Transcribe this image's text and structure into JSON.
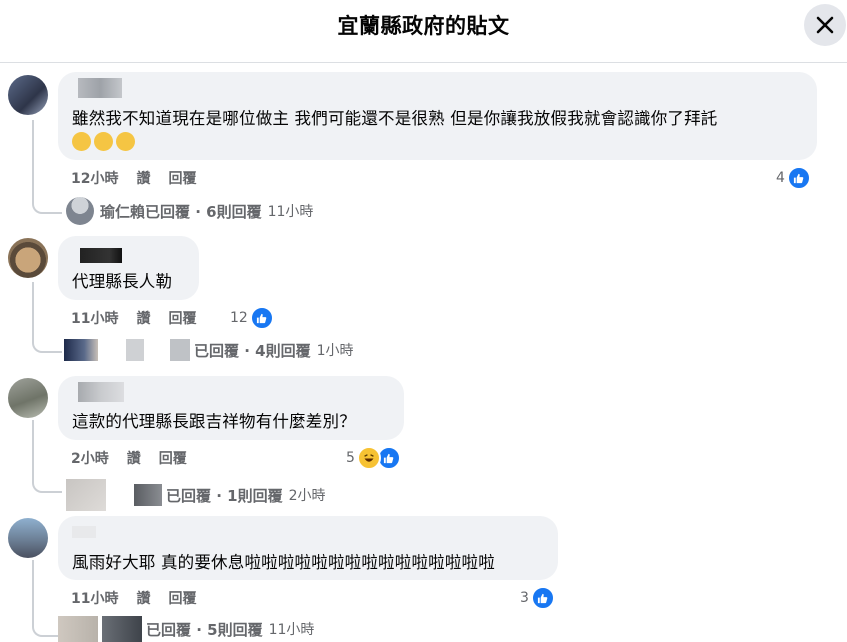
{
  "header": {
    "title": "宜蘭縣政府的貼文"
  },
  "comments": [
    {
      "text": "雖然我不知道現在是哪位做主 我們可能還不是很熟 但是你讓我放假我就會認識你了拜託",
      "emojis": [
        "pleading-face",
        "pleading-face",
        "pleading-face"
      ],
      "time": "12小時",
      "like": "讚",
      "reply": "回覆",
      "reactions": "4",
      "reply_summary": {
        "name": "瑜仁賴",
        "text": "已回覆 · 6則回覆",
        "time": "11小時"
      }
    },
    {
      "text": "代理縣長人勒",
      "time": "11小時",
      "like": "讚",
      "reply": "回覆",
      "reactions": "12",
      "reply_summary": {
        "text": "已回覆 · 4則回覆",
        "time": "1小時"
      }
    },
    {
      "text": "這款的代理縣長跟吉祥物有什麼差別？",
      "time": "2小時",
      "like": "讚",
      "reply": "回覆",
      "reactions": "5",
      "reply_summary": {
        "text": "已回覆 · 1則回覆",
        "time": "2小時"
      }
    },
    {
      "text": "風雨好大耶 真的要休息啦啦啦啦啦啦啦啦啦啦啦啦啦啦啦",
      "time": "11小時",
      "like": "讚",
      "reply": "回覆",
      "reactions": "3",
      "reply_summary": {
        "text": "已回覆 · 5則回覆",
        "time": "11小時"
      }
    }
  ],
  "colors": {
    "like_blue": "#1877f2",
    "bubble": "#f0f2f5",
    "meta": "#65676b"
  }
}
